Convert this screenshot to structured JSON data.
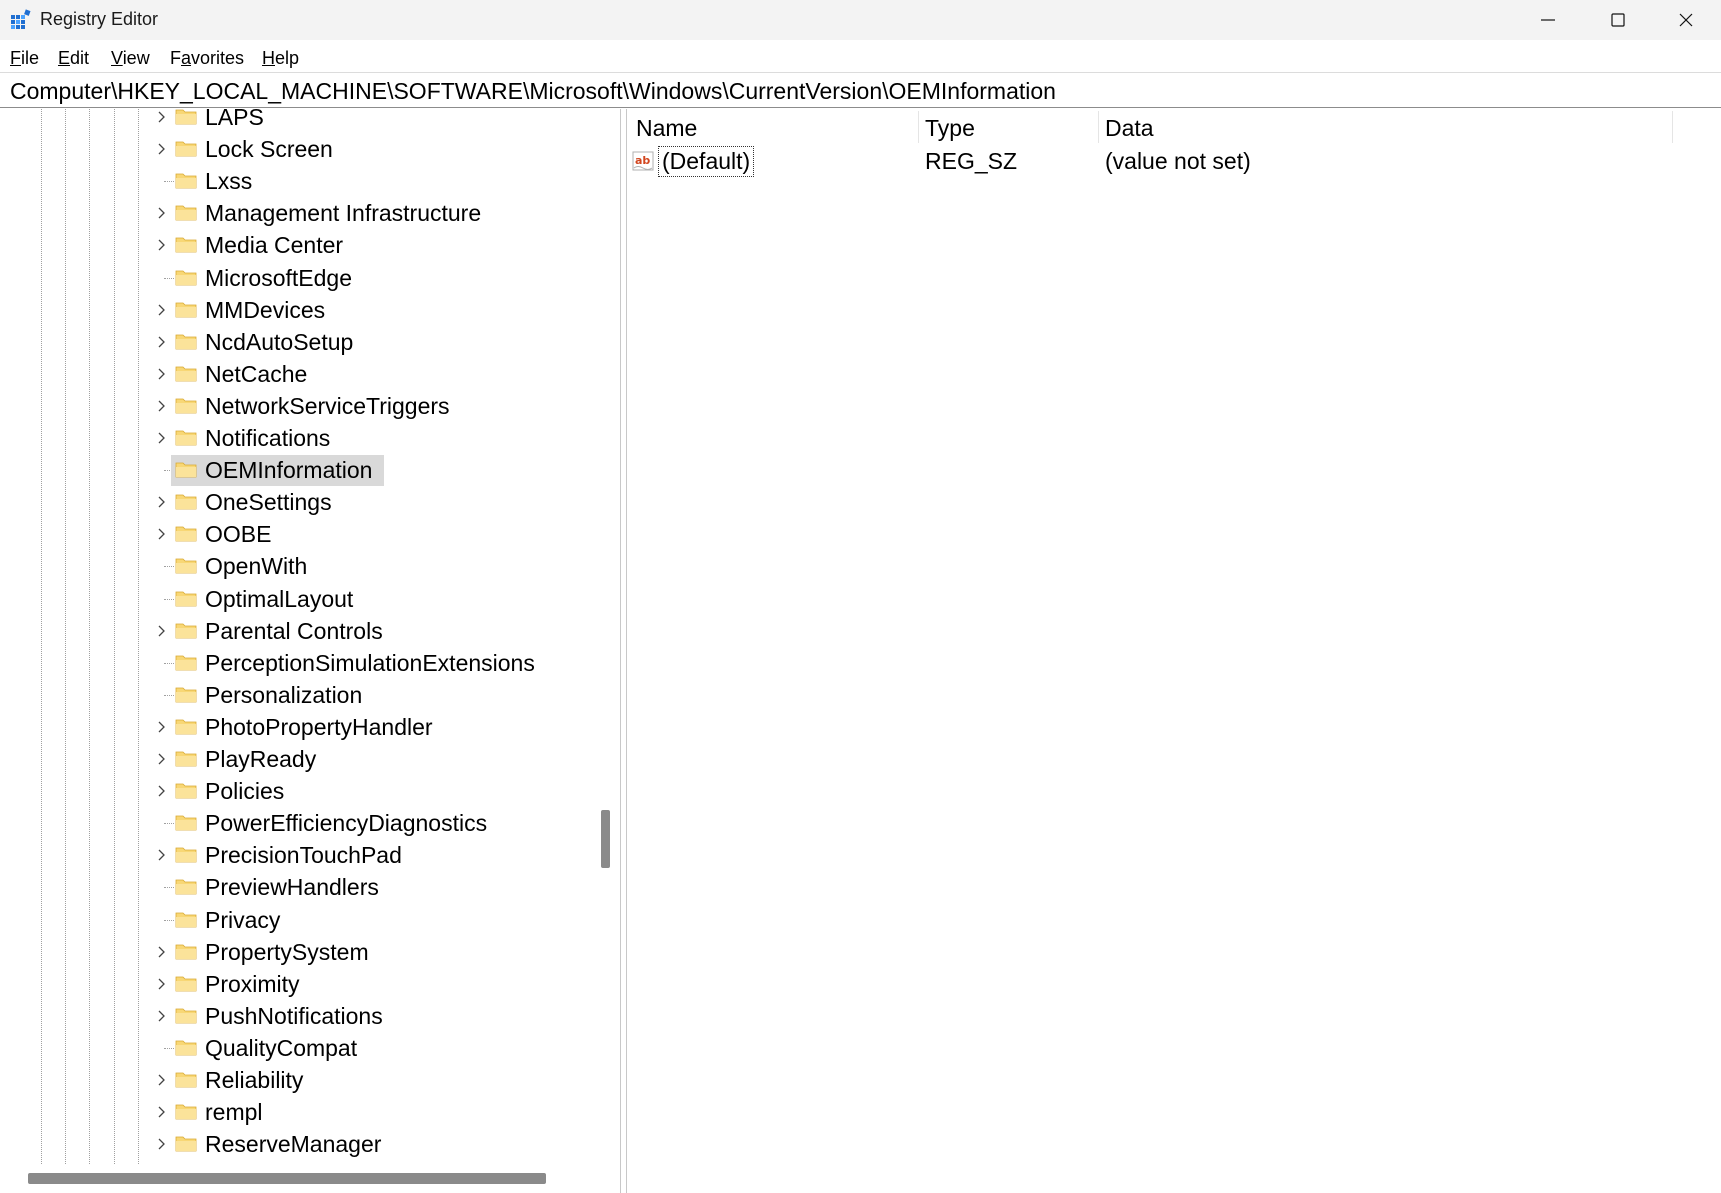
{
  "window": {
    "title": "Registry Editor",
    "icons": {
      "app": "registry-editor-icon",
      "minimize": "minimize-icon",
      "maximize": "maximize-icon",
      "close": "close-icon"
    }
  },
  "menu": {
    "file": {
      "u": "F",
      "rest": "ile"
    },
    "edit": {
      "u": "E",
      "rest": "dit"
    },
    "view": {
      "u": "V",
      "rest": "iew"
    },
    "favorites": {
      "pre": "F",
      "u": "a",
      "rest": "vorites"
    },
    "help": {
      "u": "H",
      "rest": "elp"
    }
  },
  "address": "Computer\\HKEY_LOCAL_MACHINE\\SOFTWARE\\Microsoft\\Windows\\CurrentVersion\\OEMInformation",
  "tree": {
    "items": [
      {
        "label": "LAPS",
        "expandable": true
      },
      {
        "label": "Lock Screen",
        "expandable": true
      },
      {
        "label": "Lxss",
        "expandable": false
      },
      {
        "label": "Management Infrastructure",
        "expandable": true
      },
      {
        "label": "Media Center",
        "expandable": true
      },
      {
        "label": "MicrosoftEdge",
        "expandable": false
      },
      {
        "label": "MMDevices",
        "expandable": true
      },
      {
        "label": "NcdAutoSetup",
        "expandable": true
      },
      {
        "label": "NetCache",
        "expandable": true
      },
      {
        "label": "NetworkServiceTriggers",
        "expandable": true
      },
      {
        "label": "Notifications",
        "expandable": true
      },
      {
        "label": "OEMInformation",
        "expandable": false,
        "selected": true
      },
      {
        "label": "OneSettings",
        "expandable": true
      },
      {
        "label": "OOBE",
        "expandable": true
      },
      {
        "label": "OpenWith",
        "expandable": false
      },
      {
        "label": "OptimalLayout",
        "expandable": false
      },
      {
        "label": "Parental Controls",
        "expandable": true
      },
      {
        "label": "PerceptionSimulationExtensions",
        "expandable": false
      },
      {
        "label": "Personalization",
        "expandable": false
      },
      {
        "label": "PhotoPropertyHandler",
        "expandable": true
      },
      {
        "label": "PlayReady",
        "expandable": true
      },
      {
        "label": "Policies",
        "expandable": true
      },
      {
        "label": "PowerEfficiencyDiagnostics",
        "expandable": false
      },
      {
        "label": "PrecisionTouchPad",
        "expandable": true
      },
      {
        "label": "PreviewHandlers",
        "expandable": false
      },
      {
        "label": "Privacy",
        "expandable": false
      },
      {
        "label": "PropertySystem",
        "expandable": true
      },
      {
        "label": "Proximity",
        "expandable": true
      },
      {
        "label": "PushNotifications",
        "expandable": true
      },
      {
        "label": "QualityCompat",
        "expandable": false
      },
      {
        "label": "Reliability",
        "expandable": true
      },
      {
        "label": "rempl",
        "expandable": true
      },
      {
        "label": "ReserveManager",
        "expandable": true
      }
    ]
  },
  "list": {
    "columns": {
      "name": "Name",
      "type": "Type",
      "data": "Data"
    },
    "rows": [
      {
        "name": "(Default)",
        "type": "REG_SZ",
        "data": "(value not set)",
        "icon": "reg-sz-icon"
      }
    ]
  },
  "colors": {
    "titlebar": "#f3f3f3",
    "selection": "#d9d9d9",
    "folder": "#f8d775",
    "scrollbar": "#8a8a8a"
  }
}
